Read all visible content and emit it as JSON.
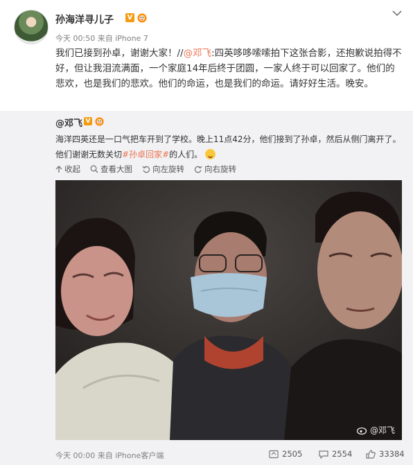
{
  "post": {
    "author": "孙海洋寻儿子",
    "verified_label": "V",
    "time": "今天 00:50",
    "source": "来自 iPhone 7",
    "text_1": "我们已接到孙卓，谢谢大家！//",
    "mention": "@邓飞",
    "text_2": ":四英哆哆嗦嗦拍下这张合影，还抱歉说拍得不好，但让我泪流满面，一个家庭14年后终于团圆，一家人终于可以回家了。他们的悲欢，也是我们的悲欢。他们的命运，也是我们的命运。请好好生活。晚安。"
  },
  "repost": {
    "author": "@邓飞",
    "verified_label": "V",
    "text_1": "海洋四英还是一口气把车开到了学校。晚上11点42分，他们接到了孙卓，然后从侧门离开了。他们谢谢无数关切",
    "topic": "#孙卓回家#",
    "text_2": "的人们。",
    "tools": {
      "collapse": "收起",
      "view_large": "查看大图",
      "rotate_left": "向左旋转",
      "rotate_right": "向右旋转"
    },
    "watermark": "@邓飞",
    "time": "今天 00:00",
    "source": "来自 iPhone客户端",
    "reposts": "2505",
    "comments": "2554",
    "likes": "33384"
  },
  "colors": {
    "accent": "#eb7350",
    "badge": "#f39c12",
    "repost_bg": "#f2f2f5"
  },
  "icons": [
    "chevron-down-icon",
    "verified-icon",
    "fan-badge-icon",
    "collapse-icon",
    "search-icon",
    "rotate-left-icon",
    "rotate-right-icon",
    "weibo-logo-icon",
    "repost-icon",
    "comment-icon",
    "like-icon"
  ]
}
